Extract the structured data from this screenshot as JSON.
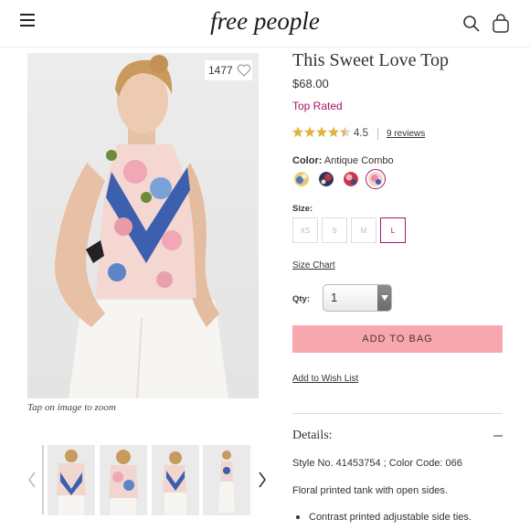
{
  "header": {
    "brand": "free people",
    "icons": [
      "menu-icon",
      "search-icon",
      "shopping-bag-icon"
    ]
  },
  "gallery": {
    "like_count": "1477",
    "zoom_hint": "Tap on image to zoom",
    "thumbnail_count": 4
  },
  "product": {
    "title": "This Sweet Love Top",
    "price": "$68.00",
    "badge": "Top Rated",
    "rating": "4.5",
    "rating_fraction": 0.9,
    "reviews": "9 reviews",
    "color_label": "Color:",
    "color_value": "Antique Combo",
    "swatches": [
      "yellow-blue",
      "navy-red",
      "red-floral",
      "pink-floral"
    ],
    "size_label": "Size:",
    "sizes": [
      "XS",
      "S",
      "M",
      "L"
    ],
    "selected_size": "L",
    "size_chart": "Size Chart",
    "qty_label": "Qty:",
    "qty_value": "1",
    "add_to_bag": "ADD TO BAG",
    "wishlist": "Add to Wish List"
  },
  "details": {
    "heading": "Details:",
    "style_line": "Style No. 41453754 ; Color Code: 066",
    "description": "Floral printed tank with open sides.",
    "bullets": [
      "Contrast printed adjustable side ties."
    ]
  },
  "colors": {
    "accent": "#a2166a",
    "button": "#f7a7ad",
    "star": "#e2b33c"
  }
}
